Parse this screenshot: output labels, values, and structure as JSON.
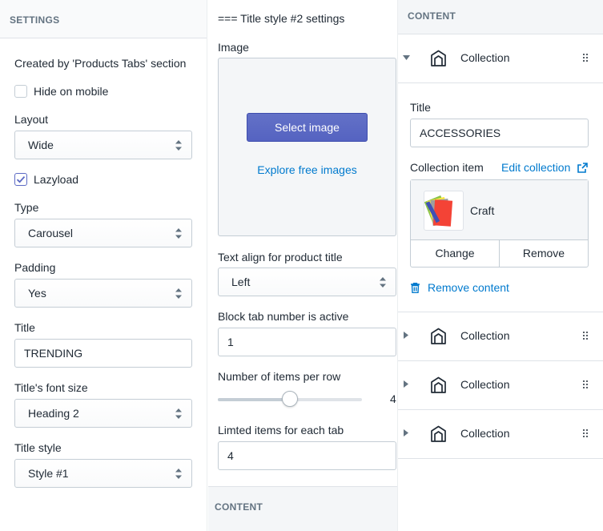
{
  "settings_panel": {
    "header": "SETTINGS",
    "created_by": "Created by 'Products Tabs' section",
    "hide_on_mobile": {
      "label": "Hide on mobile",
      "checked": false
    },
    "layout": {
      "label": "Layout",
      "value": "Wide"
    },
    "lazyload": {
      "label": "Lazyload",
      "checked": true
    },
    "type": {
      "label": "Type",
      "value": "Carousel"
    },
    "padding": {
      "label": "Padding",
      "value": "Yes"
    },
    "title": {
      "label": "Title",
      "value": "TRENDING"
    },
    "title_font_size": {
      "label": "Title's font size",
      "value": "Heading 2"
    },
    "title_style": {
      "label": "Title style",
      "value": "Style #1"
    }
  },
  "style_panel": {
    "heading": "=== Title style #2 settings",
    "image": {
      "label": "Image",
      "select_button": "Select image",
      "explore_link": "Explore free images"
    },
    "text_align": {
      "label": "Text align for product title",
      "value": "Left"
    },
    "active_tab": {
      "label": "Block tab number is active",
      "value": "1"
    },
    "items_per_row": {
      "label": "Number of items per row",
      "value": "4",
      "min": 2,
      "max": 6,
      "current": 4
    },
    "limited_items": {
      "label": "Limted items for each tab",
      "value": "4"
    },
    "footer": "CONTENT"
  },
  "content_panel": {
    "header": "CONTENT",
    "expanded_block": {
      "name": "Collection",
      "title": {
        "label": "Title",
        "value": "ACCESSORIES"
      },
      "collection_item": {
        "label": "Collection item",
        "edit_link": "Edit collection",
        "name": "Craft",
        "change": "Change",
        "remove": "Remove"
      },
      "remove_content": "Remove content"
    },
    "collapsed_blocks": [
      {
        "name": "Collection"
      },
      {
        "name": "Collection"
      },
      {
        "name": "Collection"
      }
    ]
  },
  "colors": {
    "accent": "#5c6ac4",
    "link": "#007ace",
    "text": "#212b36",
    "muted": "#637381"
  }
}
